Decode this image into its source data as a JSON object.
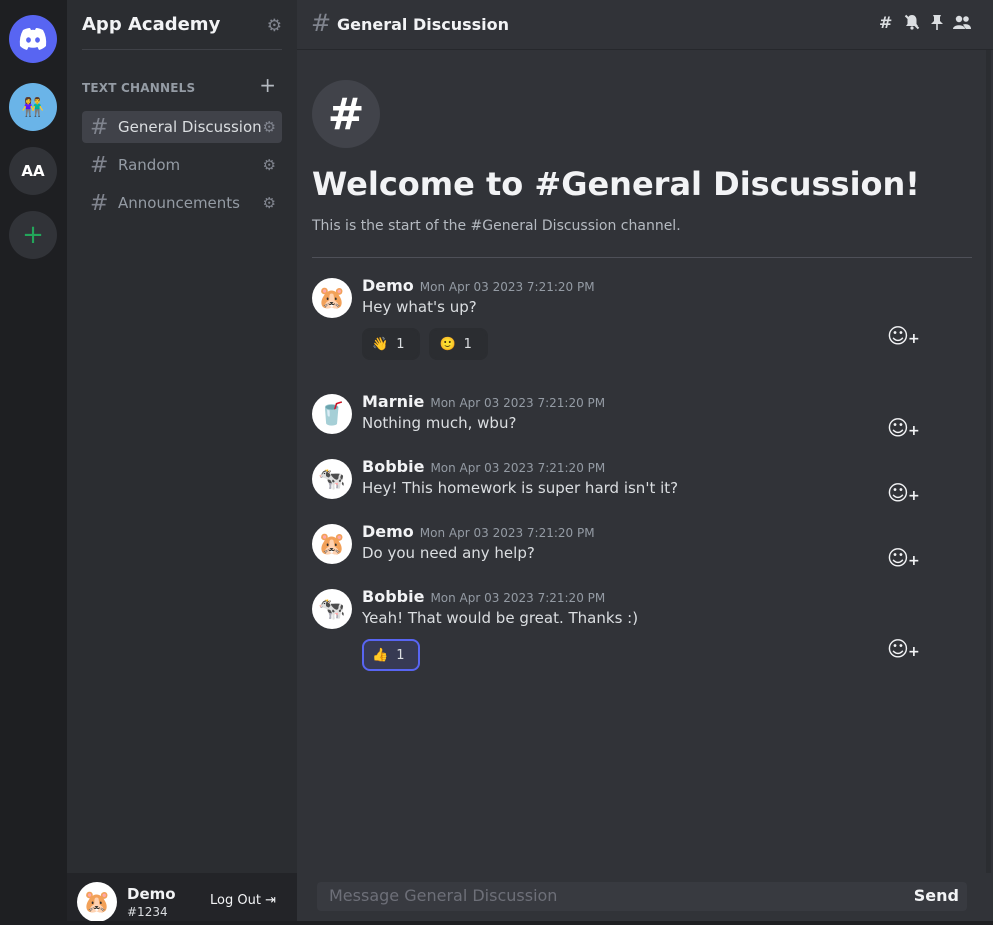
{
  "rail": {
    "home_icon": "discord-logo",
    "servers": [
      {
        "name": "App Academy",
        "icon": "people-icon",
        "glyph": "👫"
      },
      {
        "abbr": "AA"
      }
    ],
    "add_icon": "+"
  },
  "sidebar": {
    "server_name": "App Academy",
    "category": "TEXT CHANNELS",
    "channels": [
      {
        "label": "General Discussion",
        "active": true
      },
      {
        "label": "Random",
        "active": false
      },
      {
        "label": "Announcements",
        "active": false
      }
    ]
  },
  "user_panel": {
    "name": "Demo",
    "tag": "#1234",
    "logout_label": "Log Out",
    "avatar_glyph": "🐹"
  },
  "header": {
    "channel_name": "General Discussion",
    "icons": [
      "hashtag-icon",
      "mute-bell-icon",
      "pin-icon",
      "members-icon"
    ]
  },
  "welcome": {
    "title": "Welcome to #General Discussion!",
    "subtitle": "This is the start of the #General Discussion channel."
  },
  "messages": [
    {
      "author": "Demo",
      "time": "Mon Apr 03 2023 7:21:20 PM",
      "text": "Hey what's up?",
      "avatar": "🐹",
      "reactions": [
        {
          "emoji": "👋",
          "count": "1",
          "selected": false
        },
        {
          "emoji": "🙂",
          "count": "1",
          "selected": false
        }
      ]
    },
    {
      "author": "Marnie",
      "time": "Mon Apr 03 2023 7:21:20 PM",
      "text": "Nothing much, wbu?",
      "avatar": "🥤",
      "reactions": []
    },
    {
      "author": "Bobbie",
      "time": "Mon Apr 03 2023 7:21:20 PM",
      "text": "Hey! This homework is super hard isn't it?",
      "avatar": "🐄",
      "reactions": []
    },
    {
      "author": "Demo",
      "time": "Mon Apr 03 2023 7:21:20 PM",
      "text": "Do you need any help?",
      "avatar": "🐹",
      "reactions": []
    },
    {
      "author": "Bobbie",
      "time": "Mon Apr 03 2023 7:21:20 PM",
      "text": "Yeah! That would be great. Thanks :)",
      "avatar": "🐄",
      "reactions": [
        {
          "emoji": "👍",
          "count": "1",
          "selected": true
        }
      ]
    }
  ],
  "composer": {
    "placeholder": "Message General Discussion",
    "send_label": "Send"
  },
  "colors": {
    "accent": "#5865f2",
    "add_green": "#23a55a",
    "background": "#313338",
    "sidebar": "#2b2d31",
    "rail": "#1e1f22"
  }
}
